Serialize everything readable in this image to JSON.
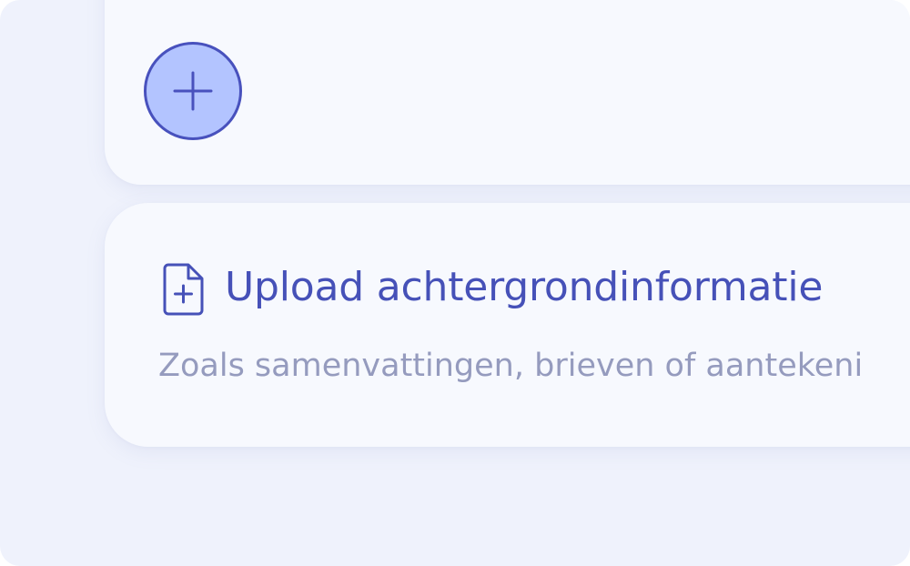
{
  "colors": {
    "background": "#eff2fc",
    "card": "#f7f9fe",
    "accent": "#4651b8",
    "add_button_fill": "#b3c4ff",
    "muted_text": "#959bbe"
  },
  "add_button": {
    "icon": "plus-icon"
  },
  "upload_card": {
    "icon": "file-plus-icon",
    "title": "Upload achtergrondinformatie",
    "subtitle": "Zoals samenvattingen, brieven of aantekeni"
  }
}
